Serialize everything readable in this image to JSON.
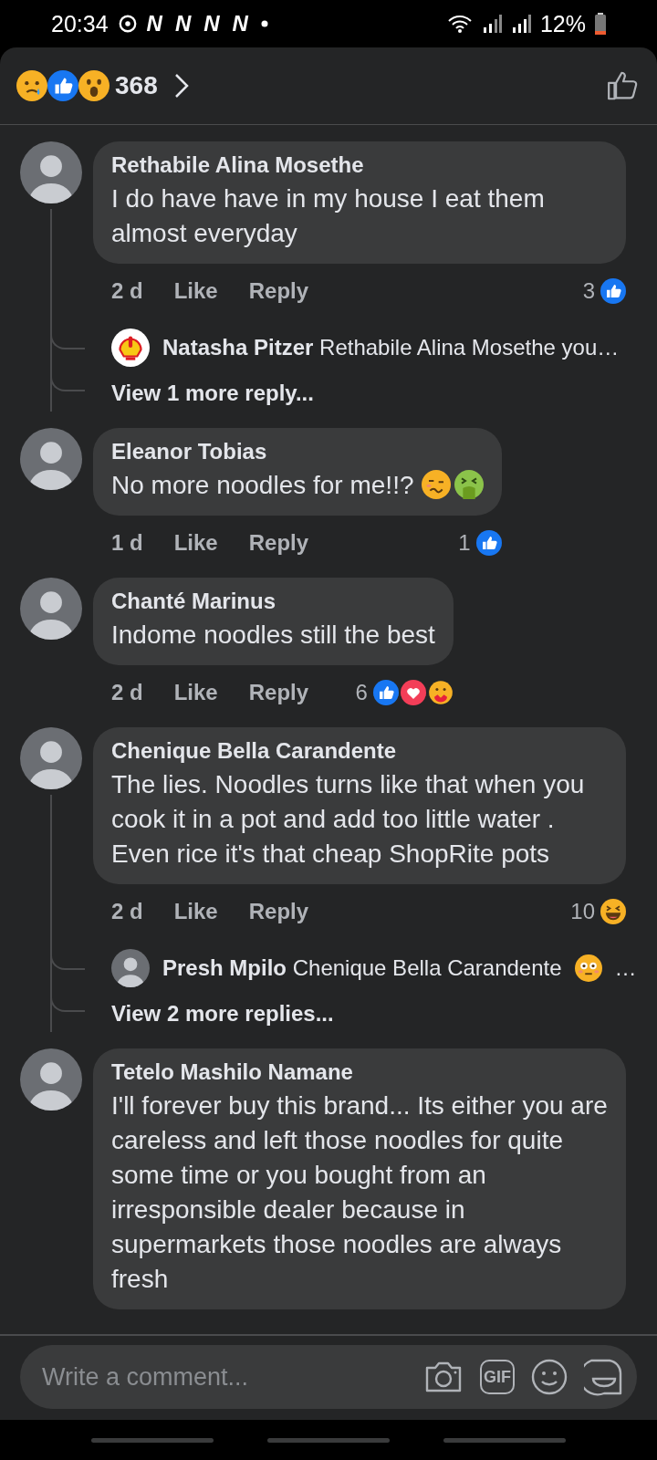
{
  "status_bar": {
    "time": "20:34",
    "notification_icons": [
      "N",
      "N",
      "N",
      "N"
    ],
    "battery": "12%"
  },
  "header": {
    "reactions": [
      {
        "kind": "sad"
      },
      {
        "kind": "like"
      },
      {
        "kind": "wow"
      }
    ],
    "count": "368"
  },
  "comments": [
    {
      "author": "Rethabile Alina Mosethe",
      "text": "I do have have in my house I eat them almost everyday",
      "age": "2 d",
      "like": "Like",
      "reply": "Reply",
      "reaction_count": "3",
      "reactions": [
        {
          "kind": "like"
        }
      ],
      "replies": [
        {
          "kind": "logo",
          "author": "Natasha Pitzer",
          "text": "Rethabile Alina Mosethe you…"
        }
      ],
      "view_more": "View 1 more reply..."
    },
    {
      "author": "Eleanor Tobias",
      "text": "No more noodles for me!!?",
      "emoji": [
        {
          "kind": "woozy"
        },
        {
          "kind": "vomit"
        }
      ],
      "age": "1 d",
      "like": "Like",
      "reply": "Reply",
      "reaction_count": "1",
      "reactions": [
        {
          "kind": "like"
        }
      ]
    },
    {
      "author": "Chanté Marinus",
      "text": "Indome noodles still the best",
      "age": "2 d",
      "like": "Like",
      "reply": "Reply",
      "reaction_count": "6",
      "reactions": [
        {
          "kind": "like"
        },
        {
          "kind": "love"
        },
        {
          "kind": "care"
        }
      ]
    },
    {
      "author": "Chenique Bella Carandente",
      "text": "The lies. Noodles turns like that when you cook it in a pot and add too little water . Even rice it's that cheap ShopRite pots",
      "age": "2 d",
      "like": "Like",
      "reply": "Reply",
      "reaction_count": "10",
      "reactions": [
        {
          "kind": "haha"
        }
      ],
      "replies": [
        {
          "kind": "photo",
          "author": "Presh Mpilo",
          "text": "Chenique Bella Carandente",
          "emoji": [
            {
              "kind": "flushed"
            }
          ],
          "tail": "…"
        }
      ],
      "view_more": "View 2 more replies..."
    },
    {
      "author": "Tetelo Mashilo Namane",
      "text": "I'll forever buy this brand... Its either you are careless and left those noodles for quite some time or you bought from an irresponsible dealer because in supermarkets those noodles are always fresh"
    }
  ],
  "composer": {
    "placeholder": "Write a comment...",
    "gif_label": "GIF"
  }
}
